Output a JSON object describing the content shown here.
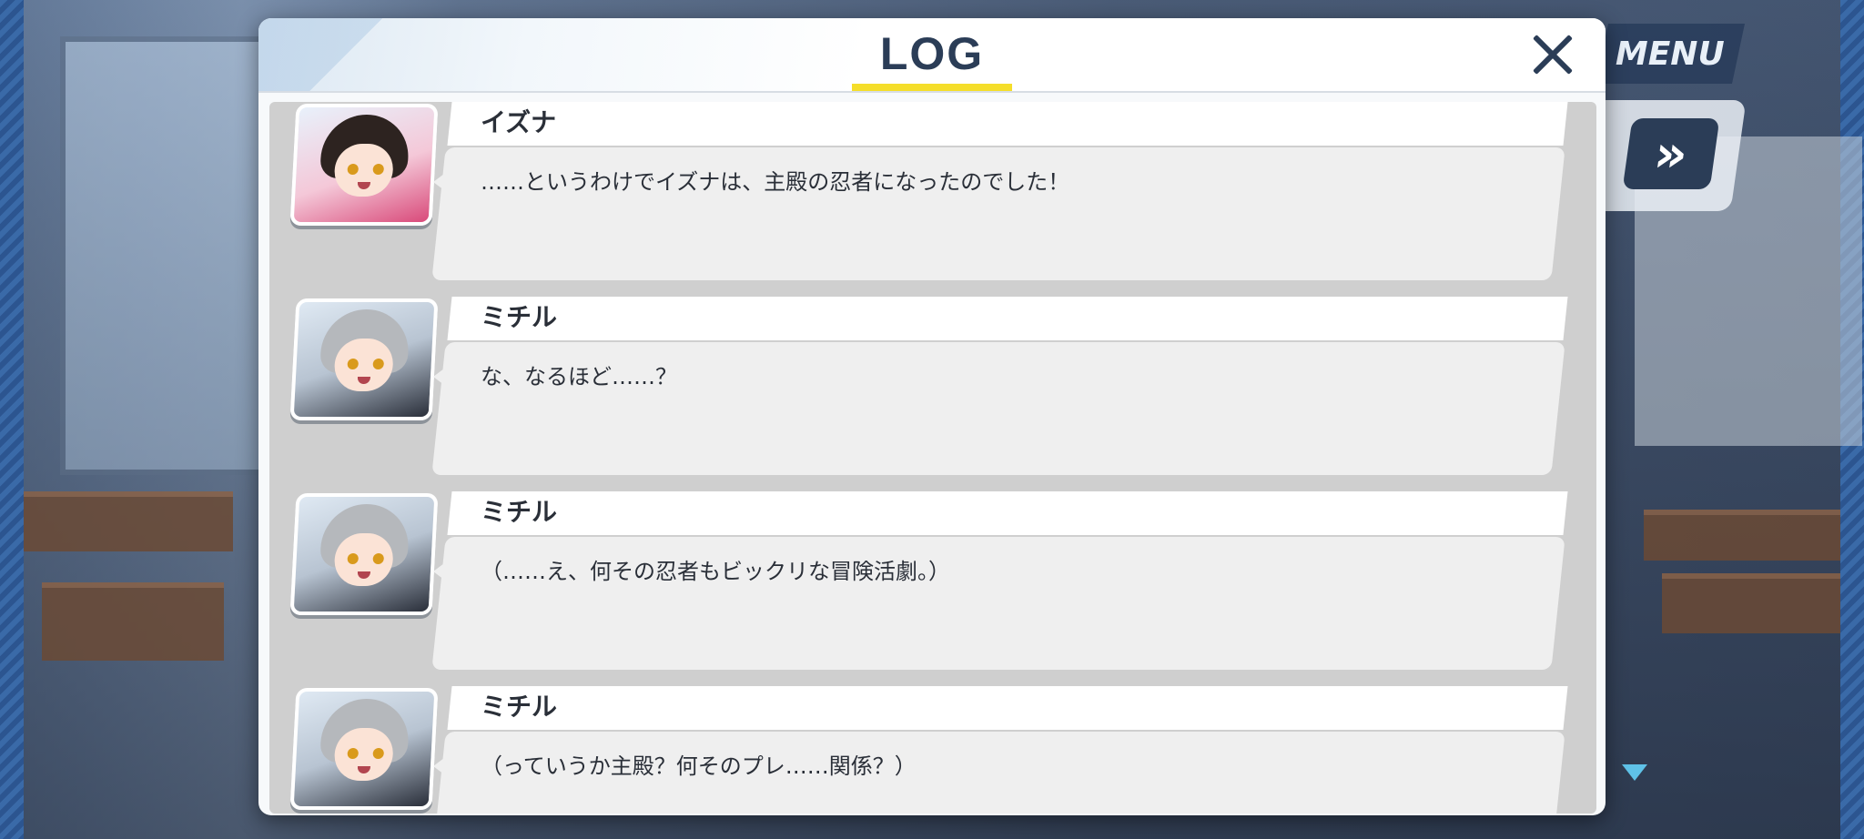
{
  "dialog": {
    "title": "LOG",
    "close_label": "×"
  },
  "hud": {
    "menu_label": "MENU",
    "skip_icon": "fast-forward-icon",
    "scroll_indicator": "down-triangle-icon"
  },
  "colors": {
    "title_text": "#2b3d57",
    "title_underline": "#f5de2a",
    "log_background": "#cfcfcf",
    "text_box": "#efefef"
  },
  "entries": [
    {
      "speaker": "イズナ",
      "text": "……というわけでイズナは、主殿の忍者になったのでした！",
      "portrait": "izuna-portrait"
    },
    {
      "speaker": "ミチル",
      "text": "な、なるほど……？",
      "portrait": "michiru-portrait"
    },
    {
      "speaker": "ミチル",
      "text": "（……え、何その忍者もビックリな冒険活劇。）",
      "portrait": "michiru-portrait"
    },
    {
      "speaker": "ミチル",
      "text": "（っていうか主殿？何そのプレ……関係？）",
      "portrait": "michiru-portrait"
    }
  ]
}
